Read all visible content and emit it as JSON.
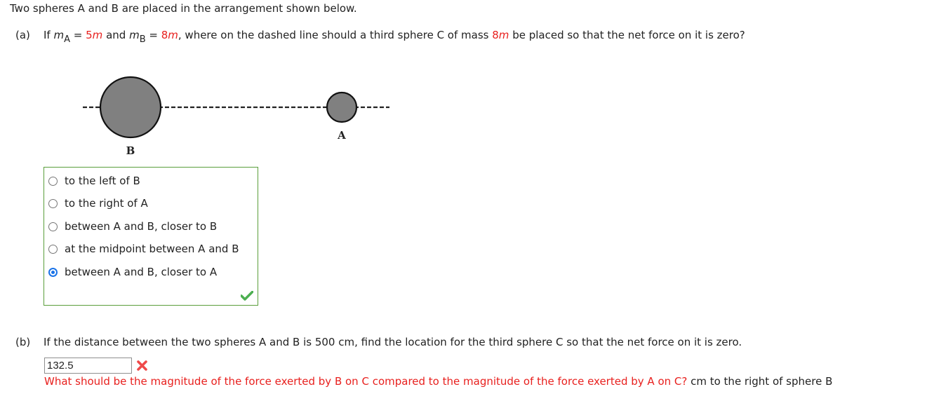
{
  "intro": "Two spheres A and B are placed in the arrangement shown below.",
  "part_a": {
    "label": "(a)",
    "q_if": "If ",
    "m": "m",
    "sub_a": "A",
    "eq1": " = ",
    "val_a": "5",
    "and": " and ",
    "sub_b": "B",
    "eq2": " = ",
    "val_b": "8",
    "mid": ", where on the dashed line should a third sphere C of mass ",
    "val_c": "8",
    "end": " be placed so that the net force on it is zero?"
  },
  "diagram": {
    "sphere_b_label": "B",
    "sphere_a_label": "A"
  },
  "choices": [
    {
      "label": "to the left of B",
      "selected": false
    },
    {
      "label": "to the right of A",
      "selected": false
    },
    {
      "label": "between A and B, closer to B",
      "selected": false
    },
    {
      "label": "at the midpoint between A and B",
      "selected": false
    },
    {
      "label": "between A and B, closer to A",
      "selected": true
    }
  ],
  "choices_status": "correct",
  "part_b": {
    "label": "(b)",
    "question": "If the distance between the two spheres A and B is 500 cm, find the location for the third sphere C so that the net force on it is zero.",
    "answer_value": "132.5",
    "answer_status": "incorrect",
    "feedback": "What should be the magnitude of the force exerted by B on C compared to the magnitude of the force exerted by A on C?",
    "unit_suffix": " cm to the right of sphere B"
  },
  "colors": {
    "highlight_red": "#e8201e",
    "correct_green": "#5a9e3b",
    "radio_blue": "#1a73e8",
    "sphere_fill": "#808080"
  }
}
